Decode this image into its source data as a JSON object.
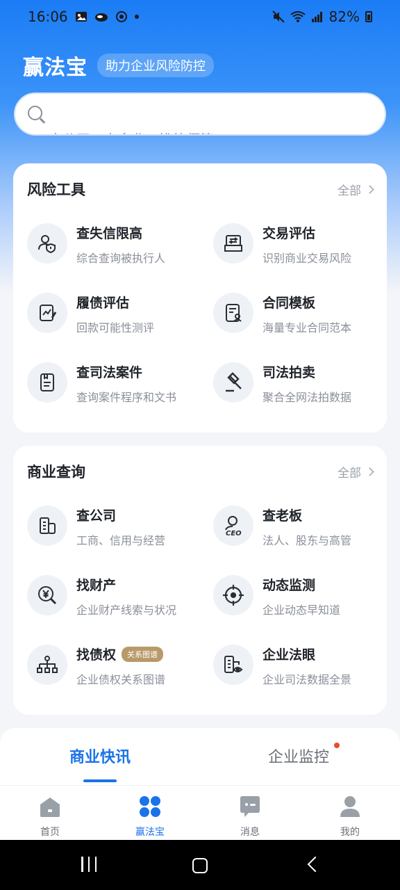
{
  "status_bar": {
    "time": "16:06",
    "battery": "82%",
    "icons": [
      "gallery-icon",
      "cloud-icon",
      "target-icon",
      "dot-icon",
      "mute-icon",
      "wifi-icon",
      "signal-icon",
      "battery-icon"
    ]
  },
  "header": {
    "title": "赢法宝",
    "tag": "助力企业风险防控"
  },
  "search": {
    "hint": "查公司 · 查企业 · 找律师等"
  },
  "risk_tools": {
    "title": "风险工具",
    "all_label": "全部",
    "items": [
      {
        "title": "查失信限高",
        "sub": "综合查询被执行人",
        "icon": "person-shield-icon"
      },
      {
        "title": "交易评估",
        "sub": "识别商业交易风险",
        "icon": "tray-exchange-icon"
      },
      {
        "title": "履债评估",
        "sub": "回款可能性测评",
        "icon": "chart-pen-icon"
      },
      {
        "title": "合同模板",
        "sub": "海量专业合同范本",
        "icon": "contract-icon"
      },
      {
        "title": "查司法案件",
        "sub": "查询案件程序和文书",
        "icon": "case-file-icon"
      },
      {
        "title": "司法拍卖",
        "sub": "聚合全网法拍数据",
        "icon": "gavel-icon"
      }
    ]
  },
  "business_query": {
    "title": "商业查询",
    "all_label": "全部",
    "items": [
      {
        "title": "查公司",
        "sub": "工商、信用与经营",
        "icon": "building-icon",
        "badge": ""
      },
      {
        "title": "查老板",
        "sub": "法人、股东与高管",
        "icon": "ceo-icon",
        "badge": ""
      },
      {
        "title": "找财产",
        "sub": "企业财产线索与状况",
        "icon": "yen-search-icon",
        "badge": ""
      },
      {
        "title": "动态监测",
        "sub": "企业动态早知道",
        "icon": "crosshair-icon",
        "badge": ""
      },
      {
        "title": "找债权",
        "sub": "企业债权关系图谱",
        "icon": "org-tree-icon",
        "badge": "关系图谱"
      },
      {
        "title": "企业法眼",
        "sub": "企业司法数据全景",
        "icon": "building-eye-icon",
        "badge": ""
      }
    ]
  },
  "feed_tabs": {
    "tab1": "商业快讯",
    "tab2": "企业监控"
  },
  "bottom_nav": {
    "home": "首页",
    "yingfabao": "赢法宝",
    "messages": "消息",
    "mine": "我的"
  },
  "colors": {
    "accent": "#1a73e8",
    "hero_top": "#1a7cf5",
    "badge_gold": "#b89a6a",
    "notice_red": "#f0472e"
  }
}
